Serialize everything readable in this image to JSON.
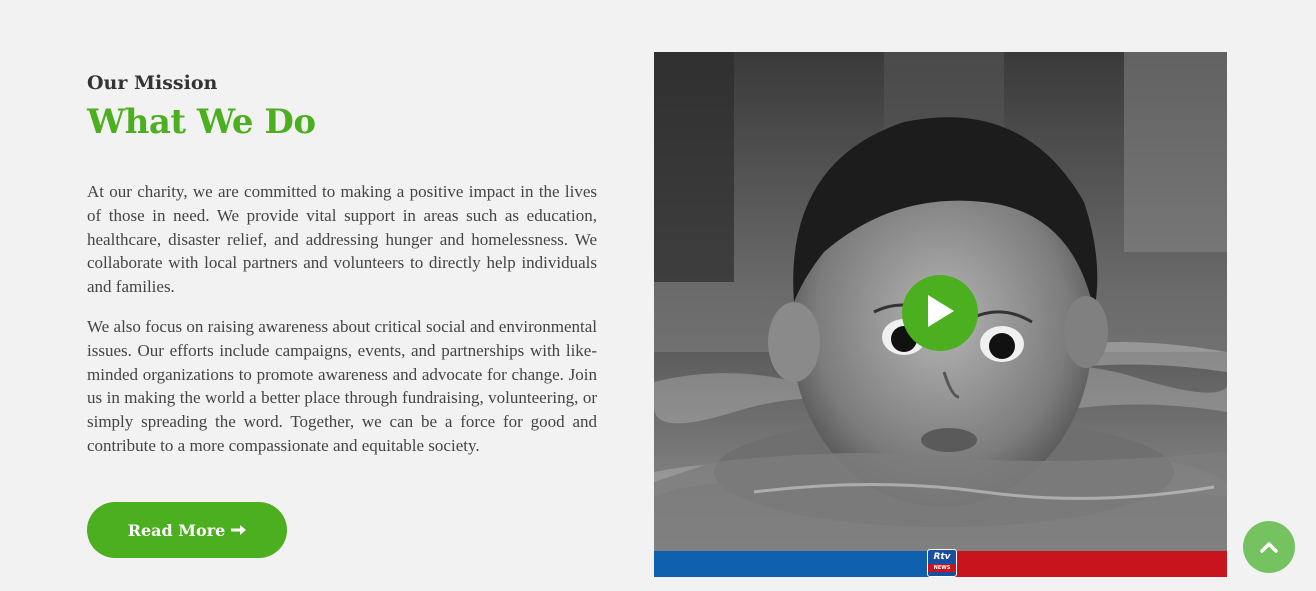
{
  "mission": {
    "eyebrow": "Our Mission",
    "heading": "What We Do",
    "paragraph1": "At our charity, we are committed to making a positive impact in the lives of those in need. We provide vital support in areas such as education, healthcare, disaster relief, and addressing hunger and homelessness. We collaborate with local partners and volunteers to directly help individuals and families.",
    "paragraph2": "We also focus on raising awareness about critical social and environmental issues. Our efforts include campaigns, events, and partnerships with like-minded organizations to promote awareness and advocate for change. Join us in making the world a better place through fundraising, volunteering, or simply spreading the word. Together, we can be a force for good and contribute to a more compassionate and equitable society.",
    "read_more_label": "Read More",
    "read_more_icon": "arrow-right-icon"
  },
  "video": {
    "play_icon": "play-icon",
    "banner_logo": "Rtv",
    "banner_logo_sub": "NEWS"
  },
  "scroll_top": {
    "icon": "chevron-up-icon"
  },
  "colors": {
    "accent": "#4caf1f",
    "scroll_button": "#74c260",
    "background": "#f2f2f2",
    "banner_blue": "#1060b0",
    "banner_red": "#c8141c"
  }
}
